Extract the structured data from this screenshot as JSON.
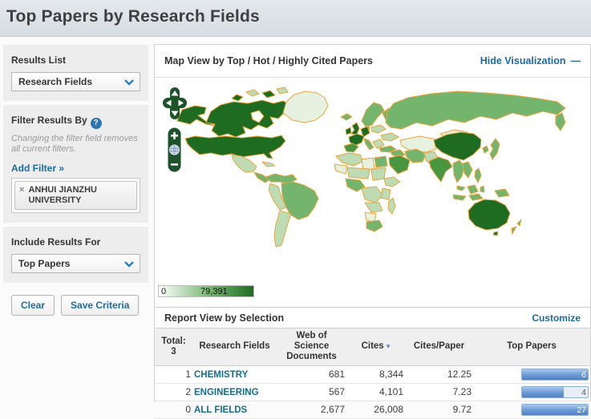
{
  "page": {
    "title": "Top Papers by Research Fields"
  },
  "sidebar": {
    "results_list": {
      "label": "Results List",
      "selected": "Research Fields"
    },
    "filter": {
      "heading": "Filter Results By",
      "note": "Changing the filter field removes all current filters.",
      "add_filter": "Add Filter »",
      "active_filter": "ANHUI JIANZHU UNIVERSITY"
    },
    "include": {
      "heading": "Include Results For",
      "selected": "Top Papers"
    },
    "buttons": {
      "clear": "Clear",
      "save": "Save Criteria"
    }
  },
  "map_panel": {
    "title": "Map View by Top / Hot / Highly Cited Papers",
    "hide_link": "Hide Visualization",
    "legend": {
      "min": "0",
      "max": "79,391"
    }
  },
  "report": {
    "title": "Report View by Selection",
    "customize": "Customize",
    "total_label": "Total:",
    "total_value": "3",
    "columns": {
      "field": "Research Fields",
      "wos": "Web of Science Documents",
      "cites": "Cites",
      "cpp": "Cites/Paper",
      "top": "Top Papers"
    },
    "sorted_column": "Cites",
    "rows": [
      {
        "rank": "1",
        "field": "CHEMISTRY",
        "wos": "681",
        "cites": "8,344",
        "cpp": "12.25",
        "top": "6",
        "bar_pct": 100
      },
      {
        "rank": "2",
        "field": "ENGINEERING",
        "wos": "567",
        "cites": "4,101",
        "cpp": "7.23",
        "top": "4",
        "bar_pct": 64
      },
      {
        "rank": "0",
        "field": "ALL FIELDS",
        "wos": "2,677",
        "cites": "26,008",
        "cpp": "9.72",
        "top": "27",
        "bar_pct": 100
      }
    ]
  },
  "icons": {
    "help": "?",
    "close": "×",
    "collapse": "—",
    "sort_desc": "▾"
  },
  "theme": {
    "link-blue": "#1a6ba6",
    "field-teal": "#136d90",
    "cites-blue": "#5585c2",
    "map-orange": "#eaa43c",
    "green-4": "#1e6b22",
    "green-3": "#48963f",
    "green-2": "#74b56d",
    "green-1": "#bedcb4",
    "green-0": "#e6f2df",
    "bar-track": "#e9eef6",
    "control-green": "#1d5328"
  }
}
